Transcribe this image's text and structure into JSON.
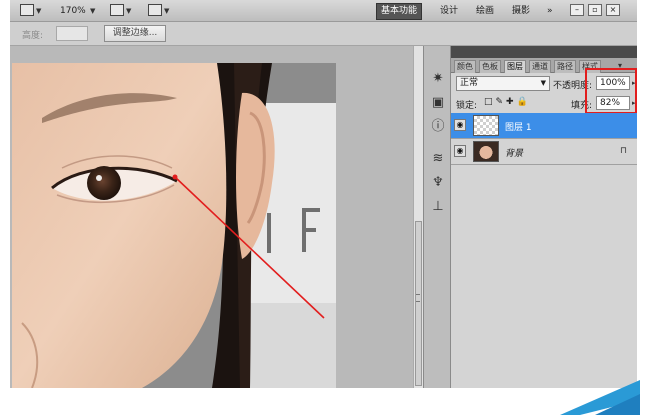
{
  "topbar": {
    "zoom": "170%",
    "workspace_label": "基本功能",
    "menus": [
      "设计",
      "绘画",
      "摄影"
    ],
    "more": "»"
  },
  "options_bar": {
    "field_label": "高度:",
    "refine_edge_button": "调整边缘..."
  },
  "panel": {
    "tabs": [
      "颜色",
      "色板",
      "图层",
      "通道",
      "路径",
      "样式"
    ],
    "active_tab": "图层",
    "blend_mode": "正常",
    "opacity_label": "不透明度:",
    "opacity_value": "100%",
    "lock_label": "锁定:",
    "fill_label": "填充:",
    "fill_value": "82%",
    "layers": [
      {
        "name": "图层 1",
        "selected": true,
        "thumb": "transparent"
      },
      {
        "name": "背景",
        "selected": false,
        "thumb": "face",
        "locked": true
      }
    ]
  },
  "tool_icons": [
    "sun-icon",
    "image-icon",
    "info-icon",
    "brush-presets-icon",
    "tool-presets-icon",
    "clone-source-icon"
  ],
  "colors": {
    "selection": "#3c8ee8",
    "highlight_box": "#e21e1e",
    "annotation_arrow": "#e21e1e"
  }
}
